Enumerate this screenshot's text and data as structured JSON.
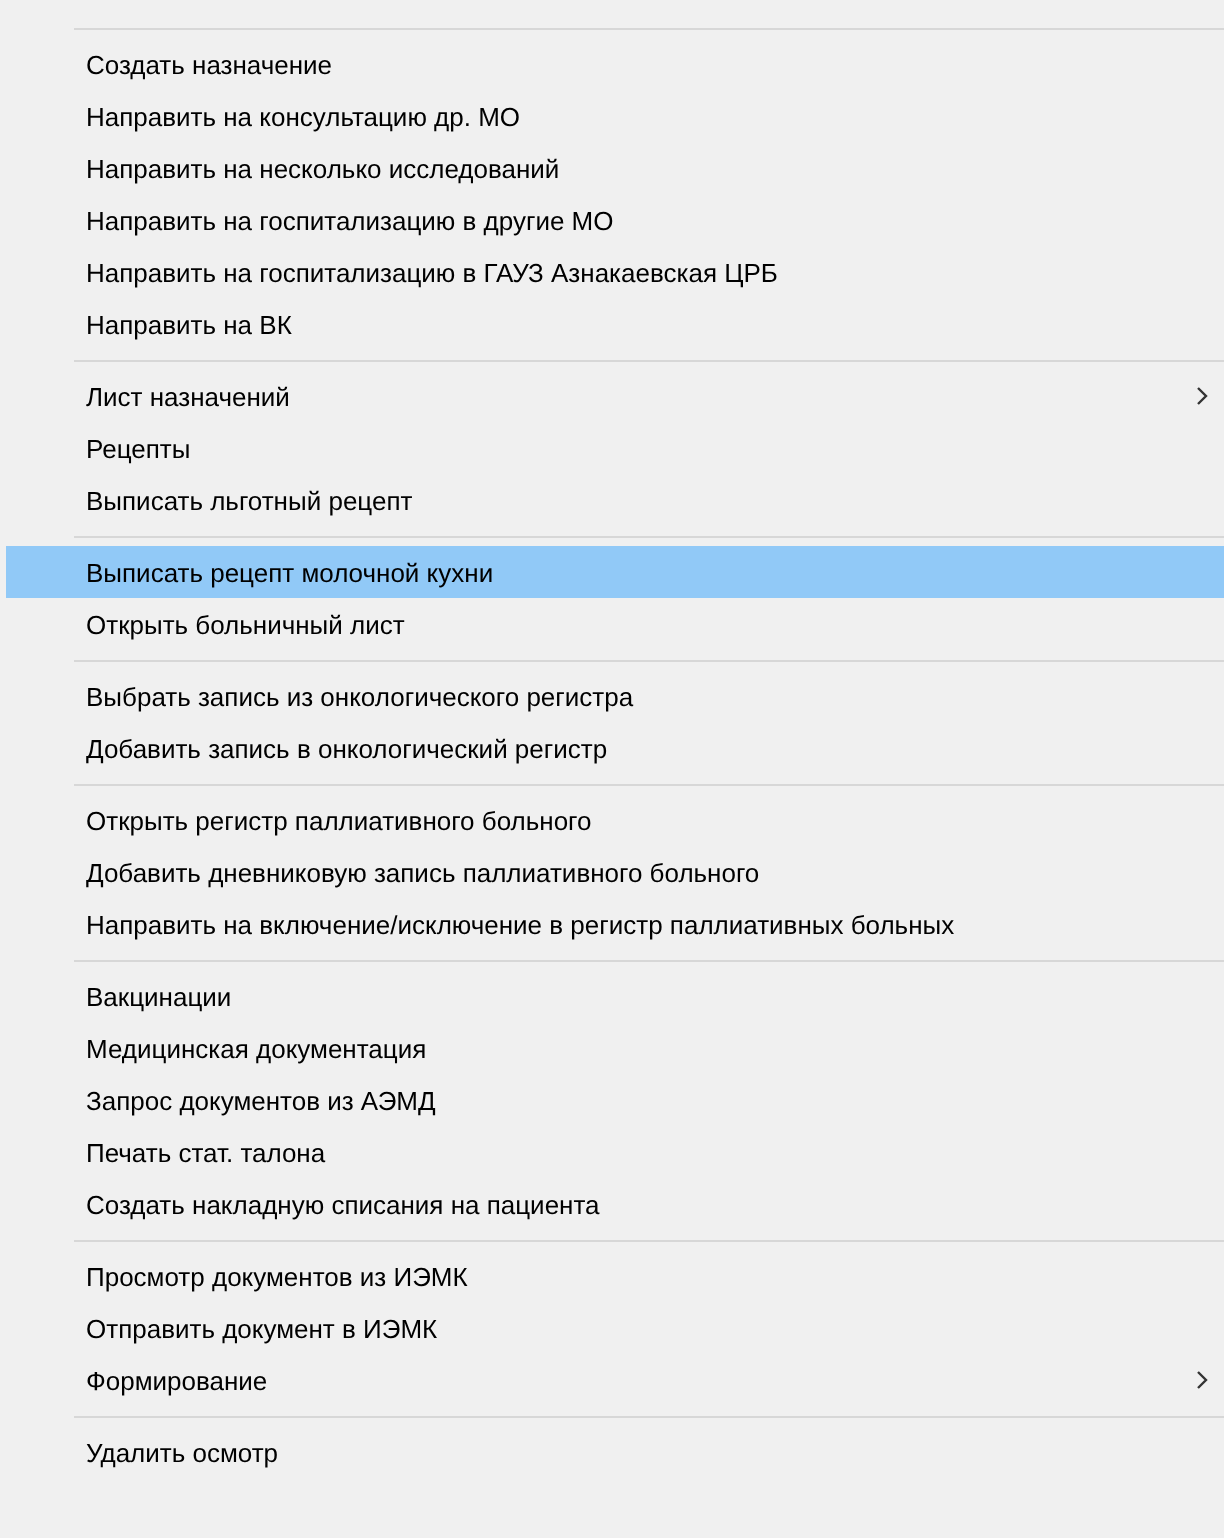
{
  "context_menu": {
    "groups": [
      {
        "items": [
          {
            "label": "Создать назначение",
            "selected": false,
            "submenu": false
          },
          {
            "label": "Направить на консультацию др. МО",
            "selected": false,
            "submenu": false
          },
          {
            "label": "Направить на несколько исследований",
            "selected": false,
            "submenu": false
          },
          {
            "label": "Направить на госпитализацию в другие МО",
            "selected": false,
            "submenu": false
          },
          {
            "label": "Направить на госпитализацию в ГАУЗ Азнакаевская ЦРБ",
            "selected": false,
            "submenu": false
          },
          {
            "label": "Направить на ВК",
            "selected": false,
            "submenu": false
          }
        ]
      },
      {
        "items": [
          {
            "label": "Лист назначений",
            "selected": false,
            "submenu": true
          },
          {
            "label": "Рецепты",
            "selected": false,
            "submenu": false
          },
          {
            "label": "Выписать льготный рецепт",
            "selected": false,
            "submenu": false
          }
        ]
      },
      {
        "items": [
          {
            "label": "Выписать рецепт молочной кухни",
            "selected": true,
            "submenu": false
          },
          {
            "label": "Открыть больничный лист",
            "selected": false,
            "submenu": false
          }
        ]
      },
      {
        "items": [
          {
            "label": "Выбрать запись из онкологического регистра",
            "selected": false,
            "submenu": false
          },
          {
            "label": "Добавить запись в онкологический регистр",
            "selected": false,
            "submenu": false
          }
        ]
      },
      {
        "items": [
          {
            "label": "Открыть регистр паллиативного больного",
            "selected": false,
            "submenu": false
          },
          {
            "label": "Добавить дневниковую запись паллиативного больного",
            "selected": false,
            "submenu": false
          },
          {
            "label": "Направить на включение/исключение в регистр паллиативных больных",
            "selected": false,
            "submenu": false
          }
        ]
      },
      {
        "items": [
          {
            "label": "Вакцинации",
            "selected": false,
            "submenu": false
          },
          {
            "label": "Медицинская документация",
            "selected": false,
            "submenu": false
          },
          {
            "label": "Запрос документов из АЭМД",
            "selected": false,
            "submenu": false
          },
          {
            "label": "Печать стат. талона",
            "selected": false,
            "submenu": false
          },
          {
            "label": "Создать накладную списания на пациента",
            "selected": false,
            "submenu": false
          }
        ]
      },
      {
        "items": [
          {
            "label": "Просмотр документов из ИЭМК",
            "selected": false,
            "submenu": false
          },
          {
            "label": "Отправить документ в ИЭМК",
            "selected": false,
            "submenu": false
          },
          {
            "label": "Формирование",
            "selected": false,
            "submenu": true
          }
        ]
      },
      {
        "items": [
          {
            "label": "Удалить осмотр",
            "selected": false,
            "submenu": false
          }
        ]
      }
    ]
  }
}
